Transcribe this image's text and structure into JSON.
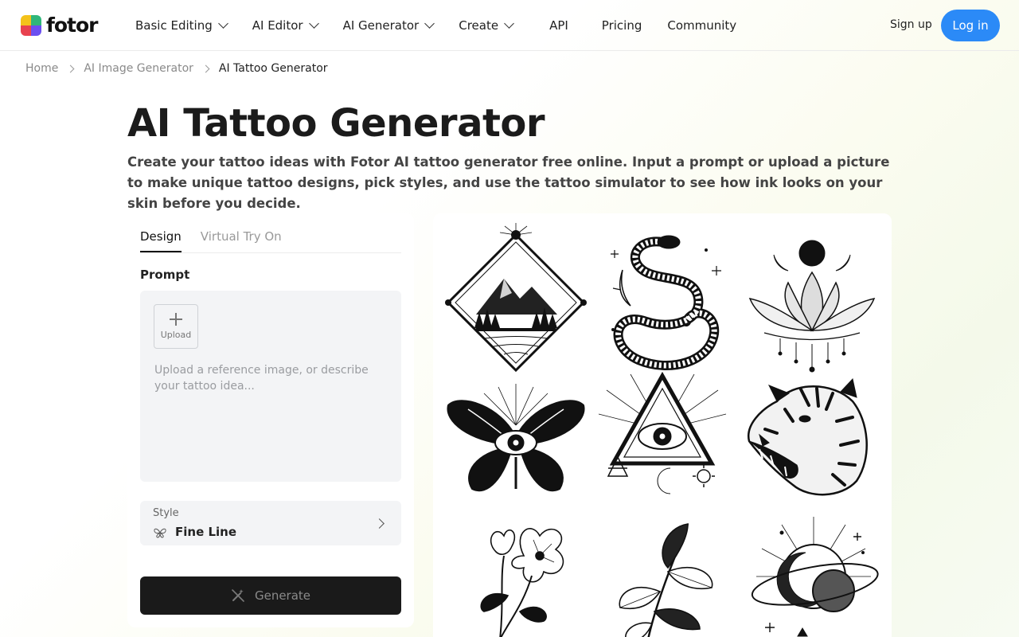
{
  "brand": {
    "name": "fotor"
  },
  "nav": {
    "items": [
      {
        "label": "Basic Editing",
        "dropdown": true
      },
      {
        "label": "AI Editor",
        "dropdown": true
      },
      {
        "label": "AI Generator",
        "dropdown": true
      },
      {
        "label": "Create",
        "dropdown": true
      },
      {
        "label": "API",
        "dropdown": false
      },
      {
        "label": "Pricing",
        "dropdown": false
      },
      {
        "label": "Community",
        "dropdown": false
      }
    ],
    "signup": "Sign up",
    "login": "Log in"
  },
  "breadcrumb": {
    "items": [
      "Home",
      "AI Image Generator",
      "AI Tattoo Generator"
    ]
  },
  "page": {
    "title": "AI Tattoo Generator",
    "subtitle": "Create your tattoo ideas with Fotor AI tattoo generator free online. Input a prompt or upload a picture to make unique tattoo designs, pick styles, and use the tattoo simulator to see how ink looks on your skin before you decide."
  },
  "panel": {
    "tabs": [
      {
        "label": "Design",
        "active": true
      },
      {
        "label": "Virtual Try On",
        "active": false
      }
    ],
    "prompt_label": "Prompt",
    "upload_label": "Upload",
    "prompt_placeholder": "Upload a reference image, or describe your tattoo idea...",
    "prompt_value": "",
    "style_label": "Style",
    "style_value": "Fine Line",
    "generate_label": "Generate"
  },
  "gallery": {
    "items": [
      "mountain-diamond-tattoo",
      "snake-tattoo",
      "lotus-tattoo",
      "butterfly-eye-tattoo",
      "all-seeing-eye-triangle-tattoo",
      "tiger-tattoo",
      "flower-tattoo",
      "leaf-branch-tattoo",
      "sun-planet-tattoo"
    ]
  },
  "colors": {
    "accent": "#2b8af7",
    "generate_bg": "#1a1a1a",
    "input_bg": "#f3f4f6"
  }
}
